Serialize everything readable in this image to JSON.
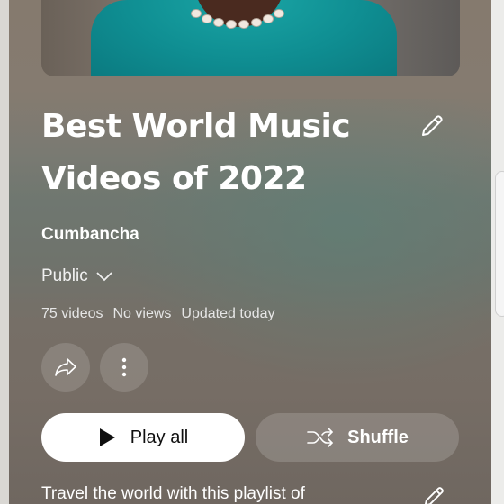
{
  "playlist": {
    "title_line1": "Best World Music",
    "title_line2": "Videos of 2022",
    "channel": "Cumbancha",
    "visibility": "Public",
    "video_count": "75 videos",
    "views": "No views",
    "updated": "Updated today",
    "description": "Travel the world with this playlist of"
  },
  "actions": {
    "play_all": "Play all",
    "shuffle": "Shuffle"
  },
  "icons": {
    "edit": "pencil-icon",
    "share": "share-icon",
    "more": "more-vertical-icon",
    "dropdown": "chevron-down-icon",
    "play": "play-icon",
    "shuffle": "shuffle-icon"
  },
  "colors": {
    "play_all_bg": "#ffffff",
    "text": "#ffffff"
  }
}
